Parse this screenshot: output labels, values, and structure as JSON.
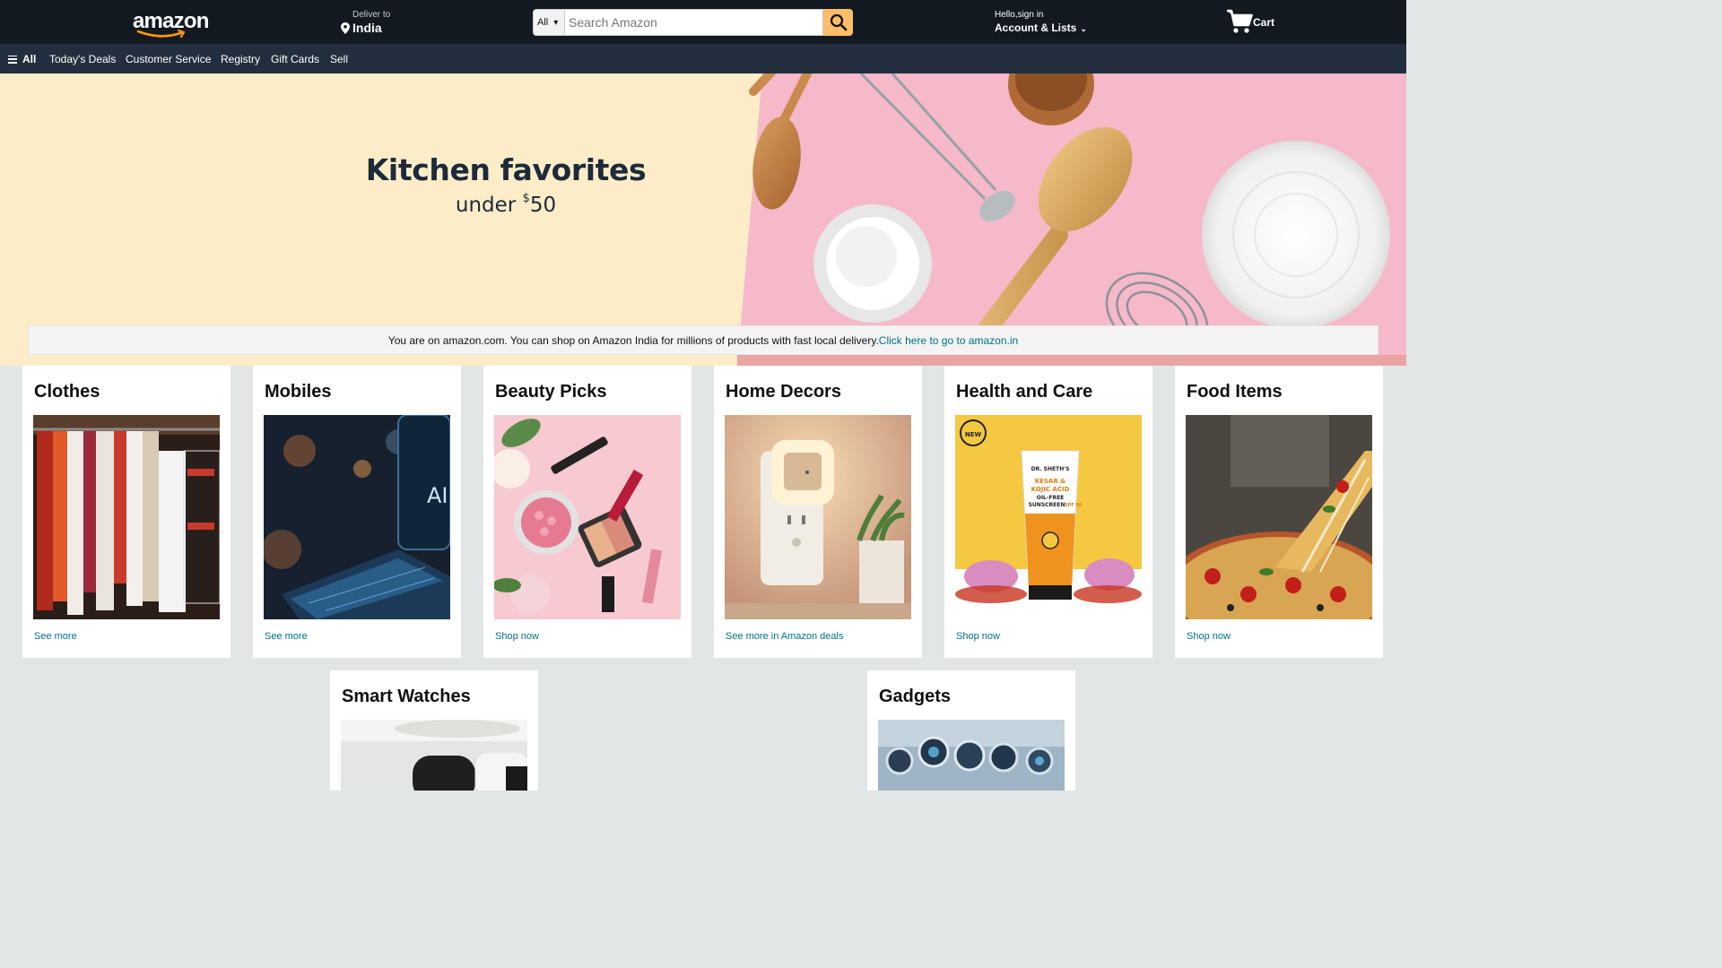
{
  "header": {
    "logo_text": "amazon",
    "deliver_label": "Deliver to",
    "deliver_country": "India",
    "search": {
      "category": "All",
      "placeholder": "Search Amazon"
    },
    "account_greeting": "Hello,sign in",
    "account_label": "Account & Lists",
    "cart_label": "Cart"
  },
  "subnav": {
    "all_label": "All",
    "items": [
      "Today's Deals",
      "Customer Service",
      "Registry",
      "Gift Cards",
      "Sell"
    ]
  },
  "hero": {
    "title": "Kitchen favorites",
    "subtitle_prefix": "under ",
    "subtitle_currency": "$",
    "subtitle_amount": "50"
  },
  "notice": {
    "text": "You are on amazon.com. You can shop on Amazon India for millions of products with fast local delivery.",
    "link": "Click here to go to amazon.in"
  },
  "cards": [
    {
      "title": "Clothes",
      "link": "See more"
    },
    {
      "title": "Mobiles",
      "link": "See more"
    },
    {
      "title": "Beauty Picks",
      "link": "Shop now"
    },
    {
      "title": "Home Decors",
      "link": "See more in Amazon deals"
    },
    {
      "title": "Health and Care",
      "link": "Shop now"
    },
    {
      "title": "Food Items",
      "link": "Shop now"
    },
    {
      "title": "Smart Watches",
      "link": ""
    },
    {
      "title": "Gadgets",
      "link": ""
    }
  ],
  "product_text": {
    "mobiles_badge": "AI",
    "sunscreen_brand": "DR. SHETH'S",
    "sunscreen_name_1": "KESAR &",
    "sunscreen_name_2": "KOJIC ACID",
    "sunscreen_name_3": "OIL-FREE",
    "sunscreen_name_4": "SUNSCREEN",
    "sunscreen_spf": "SPF 50",
    "sunscreen_badge": "NEW"
  },
  "colors": {
    "nav_bg": "#131921",
    "subnav_bg": "#232f3e",
    "search_button": "#febd69",
    "link": "#007185",
    "hero_left": "#fdecc8",
    "hero_right": "#f6b9c9"
  }
}
